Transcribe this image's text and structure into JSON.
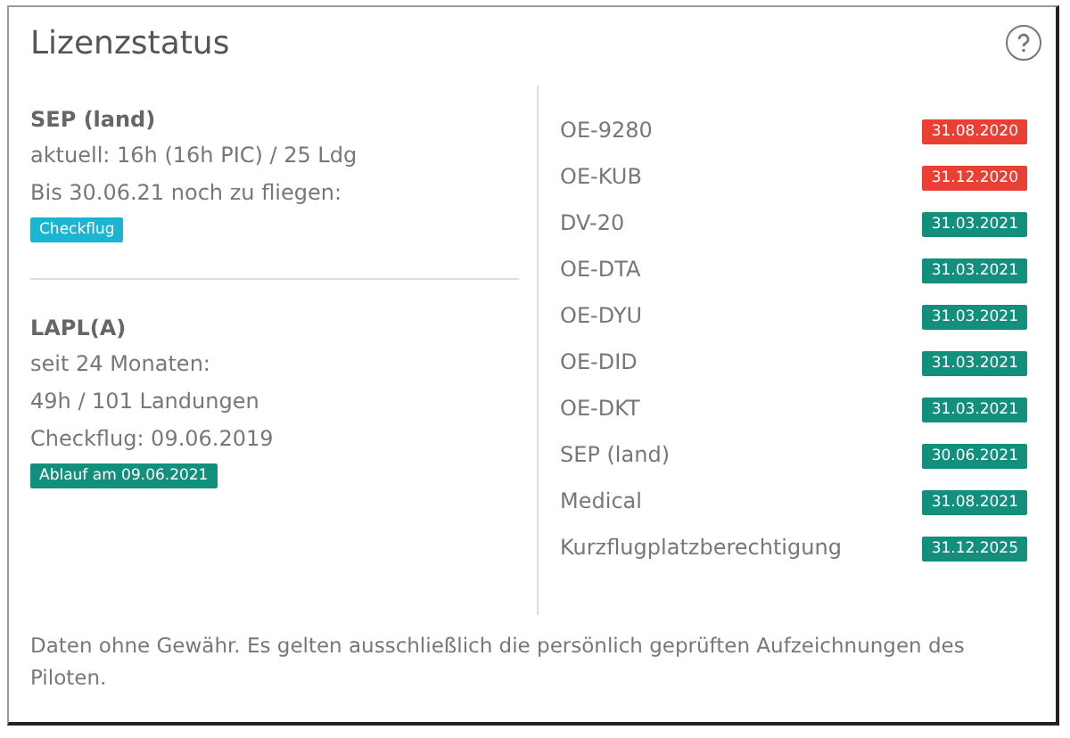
{
  "title": "Lizenzstatus",
  "licenses": [
    {
      "name": "SEP (land)",
      "lines": [
        "aktuell: 16h (16h PIC) / 25 Ldg",
        "Bis 30.06.21 noch zu fliegen:"
      ],
      "badge": {
        "label": "Checkflug",
        "color": "#1ab5d2"
      }
    },
    {
      "name": "LAPL(A)",
      "lines": [
        "seit 24 Monaten:",
        "49h / 101 Landungen",
        "Checkflug: 09.06.2019"
      ],
      "badge": {
        "label": "Ablauf am 09.06.2021",
        "color": "#138f7d"
      }
    }
  ],
  "validity": [
    {
      "name": "OE-9280",
      "date": "31.08.2020",
      "color": "#ea3f33"
    },
    {
      "name": "OE-KUB",
      "date": "31.12.2020",
      "color": "#ea3f33"
    },
    {
      "name": "DV-20",
      "date": "31.03.2021",
      "color": "#138f7d"
    },
    {
      "name": "OE-DTA",
      "date": "31.03.2021",
      "color": "#138f7d"
    },
    {
      "name": "OE-DYU",
      "date": "31.03.2021",
      "color": "#138f7d"
    },
    {
      "name": "OE-DID",
      "date": "31.03.2021",
      "color": "#138f7d"
    },
    {
      "name": "OE-DKT",
      "date": "31.03.2021",
      "color": "#138f7d"
    },
    {
      "name": "SEP (land)",
      "date": "30.06.2021",
      "color": "#138f7d"
    },
    {
      "name": "Medical",
      "date": "31.08.2021",
      "color": "#138f7d"
    },
    {
      "name": "Kurzflugplatzberechtigung",
      "date": "31.12.2025",
      "color": "#138f7d"
    }
  ],
  "footer": "Daten ohne Gewähr. Es gelten ausschließlich die persönlich geprüften Aufzeichnungen des Piloten."
}
